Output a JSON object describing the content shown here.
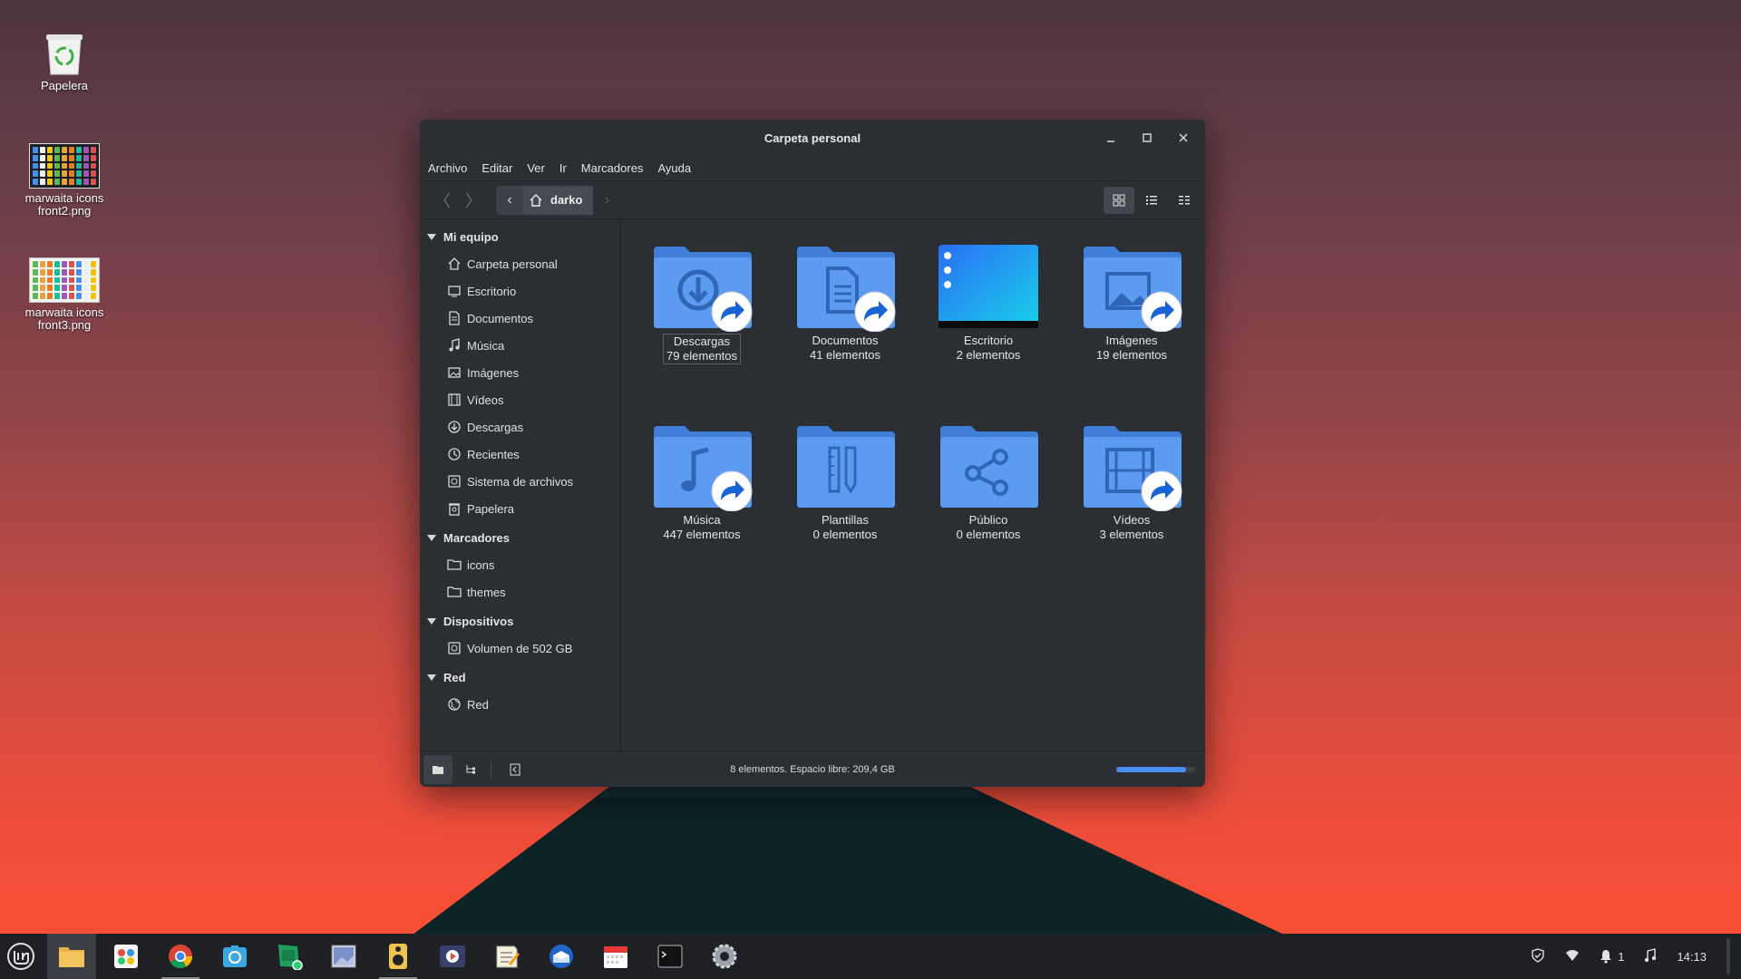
{
  "desktop": {
    "icons": [
      {
        "label": "Papelera"
      },
      {
        "label": "marwaita icons front2.png"
      },
      {
        "label": "marwaita icons front3.png"
      }
    ]
  },
  "window": {
    "title": "Carpeta personal",
    "menu": [
      "Archivo",
      "Editar",
      "Ver",
      "Ir",
      "Marcadores",
      "Ayuda"
    ],
    "path": {
      "crumb": "darko"
    },
    "view_mode": "icons"
  },
  "sidebar": {
    "sections": [
      {
        "title": "Mi equipo",
        "items": [
          {
            "label": "Carpeta personal",
            "icon": "home-icon"
          },
          {
            "label": "Escritorio",
            "icon": "desktop-icon"
          },
          {
            "label": "Documentos",
            "icon": "document-icon"
          },
          {
            "label": "Música",
            "icon": "music-icon"
          },
          {
            "label": "Imágenes",
            "icon": "image-icon"
          },
          {
            "label": "Vídeos",
            "icon": "video-icon"
          },
          {
            "label": "Descargas",
            "icon": "download-icon"
          },
          {
            "label": "Recientes",
            "icon": "clock-icon"
          },
          {
            "label": "Sistema de archivos",
            "icon": "drive-icon"
          },
          {
            "label": "Papelera",
            "icon": "trash-icon"
          }
        ]
      },
      {
        "title": "Marcadores",
        "items": [
          {
            "label": "icons",
            "icon": "folder-icon"
          },
          {
            "label": "themes",
            "icon": "folder-icon"
          }
        ]
      },
      {
        "title": "Dispositivos",
        "items": [
          {
            "label": "Volumen de 502 GB",
            "icon": "drive-icon"
          }
        ]
      },
      {
        "title": "Red",
        "items": [
          {
            "label": "Red",
            "icon": "network-icon"
          }
        ]
      }
    ]
  },
  "folders": [
    {
      "name": "Descargas",
      "count": "79 elementos",
      "emblem": true,
      "glyph": "download",
      "selected": true
    },
    {
      "name": "Documentos",
      "count": "41 elementos",
      "emblem": true,
      "glyph": "document"
    },
    {
      "name": "Escritorio",
      "count": "2 elementos",
      "emblem": false,
      "glyph": "desktop"
    },
    {
      "name": "Imágenes",
      "count": "19 elementos",
      "emblem": true,
      "glyph": "image"
    },
    {
      "name": "Música",
      "count": "447 elementos",
      "emblem": true,
      "glyph": "music"
    },
    {
      "name": "Plantillas",
      "count": "0 elementos",
      "emblem": false,
      "glyph": "template"
    },
    {
      "name": "Público",
      "count": "0 elementos",
      "emblem": false,
      "glyph": "share"
    },
    {
      "name": "Vídeos",
      "count": "3 elementos",
      "emblem": true,
      "glyph": "video"
    }
  ],
  "status": {
    "text": "8 elementos. Espacio libre: 209,4 GB",
    "used_fraction": 0.88
  },
  "taskbar": {
    "apps": [
      "menu-icon",
      "files-icon",
      "software-icon",
      "chrome-icon",
      "screenshot-icon",
      "spreadsheet-icon",
      "image-viewer-icon",
      "speaker-icon",
      "media-player-icon",
      "text-editor-icon",
      "thunderbird-icon",
      "calendar-icon",
      "terminal-icon",
      "settings-icon"
    ],
    "tray": {
      "notifications": "1",
      "clock": "14:13"
    }
  },
  "colors": {
    "accent": "#4a8ff0",
    "folder": "#5f9ef5",
    "emblem": "#1a73e8"
  }
}
